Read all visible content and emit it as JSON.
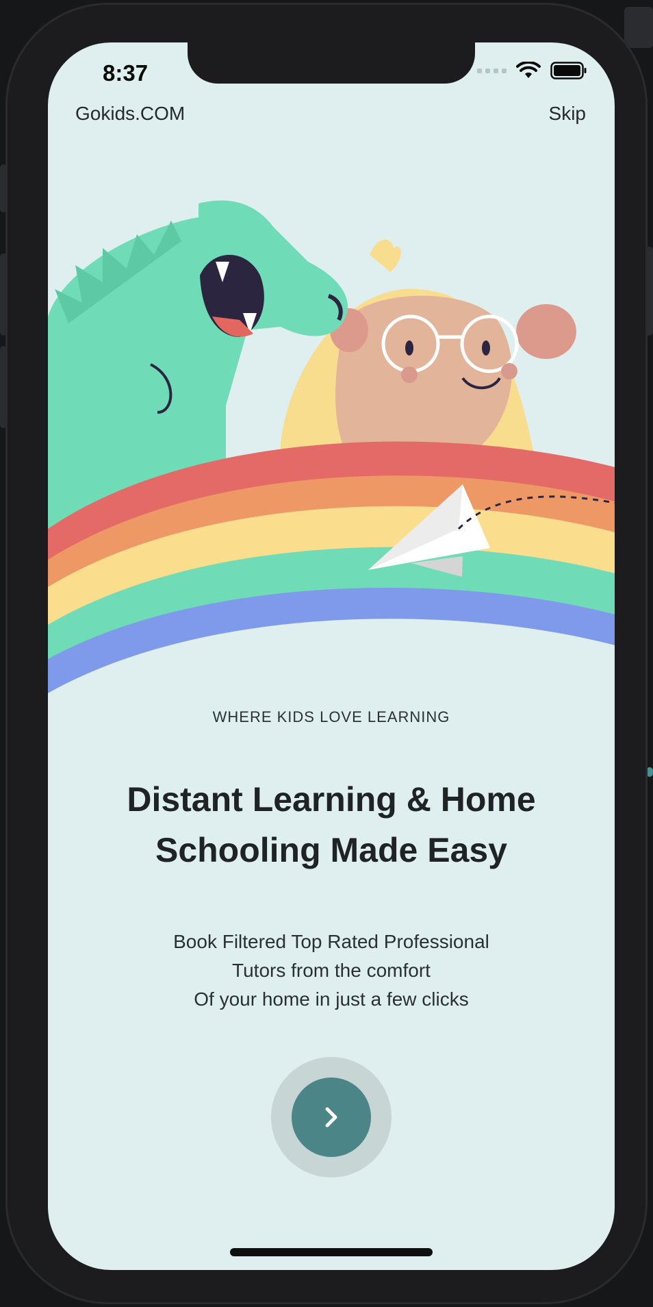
{
  "status_bar": {
    "time": "8:37"
  },
  "header": {
    "brand": "Gokids.COM",
    "skip_label": "Skip"
  },
  "hero": {
    "illustration": "dinosaur-girl-rainbow-paper-plane"
  },
  "content": {
    "eyebrow": "WHERE KIDS LOVE LEARNING",
    "headline_line1": "Distant Learning & Home",
    "headline_line2": "Schooling Made Easy",
    "body_line1": "Book Filtered Top Rated Professional",
    "body_line2": "Tutors from the comfort",
    "body_line3": "Of your home in just a few clicks"
  },
  "next_button": {
    "icon": "chevron-right-icon"
  },
  "colors": {
    "screen_bg": "#dfefef",
    "accent": "#4b8588",
    "ring": "#c7d5d5",
    "text": "#1f2326"
  }
}
